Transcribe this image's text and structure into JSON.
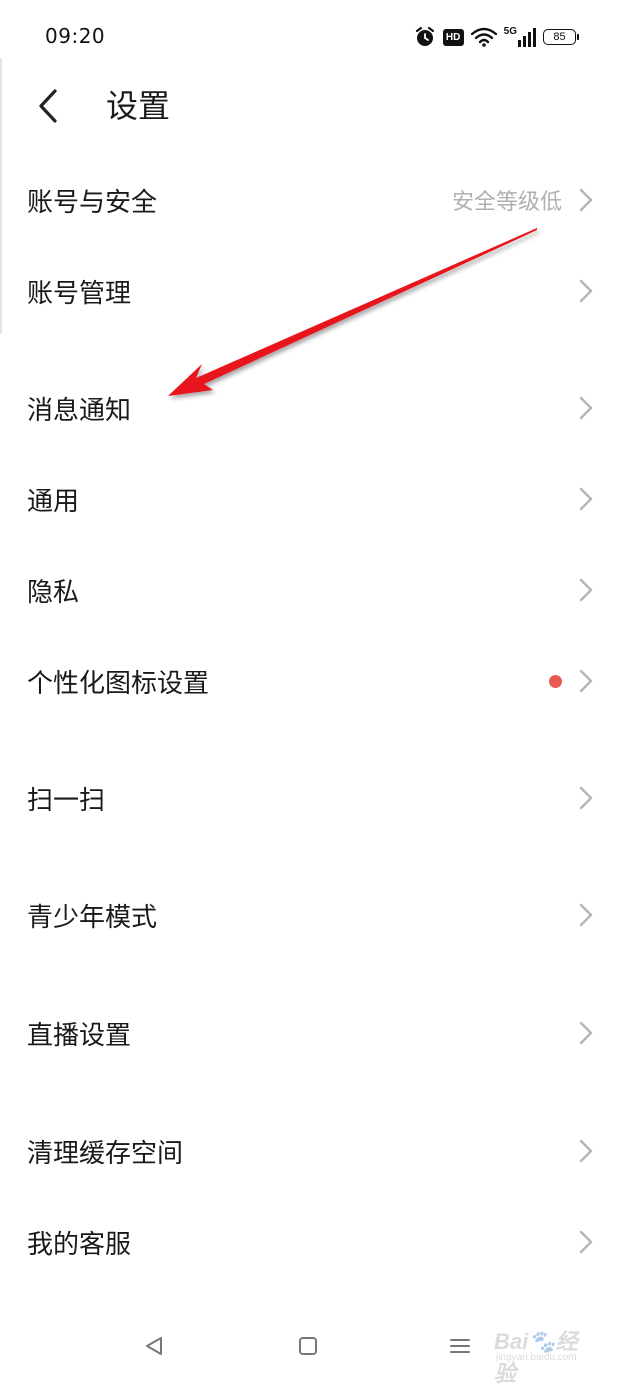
{
  "status_bar": {
    "time": "09:20",
    "hd": "HD",
    "network": "5G",
    "battery": "85"
  },
  "header": {
    "title": "设置"
  },
  "settings": {
    "items": [
      {
        "label": "账号与安全",
        "value": "安全等级低"
      },
      {
        "label": "账号管理"
      },
      {
        "label": "消息通知"
      },
      {
        "label": "通用"
      },
      {
        "label": "隐私"
      },
      {
        "label": "个性化图标设置",
        "badge_color": "#e85a4f"
      },
      {
        "label": "扫一扫"
      },
      {
        "label": "青少年模式"
      },
      {
        "label": "直播设置"
      },
      {
        "label": "清理缓存空间"
      },
      {
        "label": "我的客服"
      }
    ]
  },
  "watermark": {
    "brand": "Bai",
    "brand_suffix": "经验",
    "url": "jingyan.baidu.com"
  },
  "colors": {
    "annotation_arrow": "#e8141c",
    "chevron": "#b5b5b5",
    "secondary_text": "#b0b0b0"
  }
}
